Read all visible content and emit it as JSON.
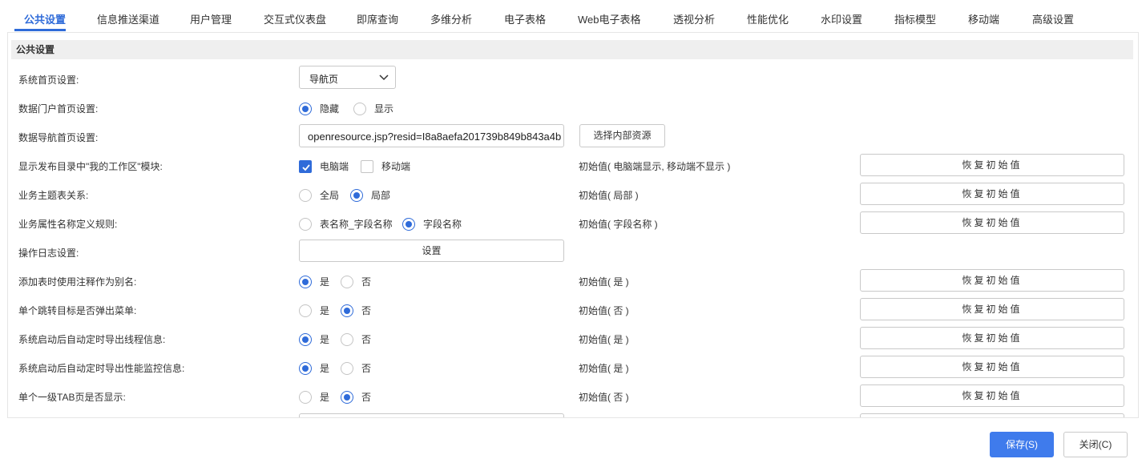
{
  "tabs": [
    {
      "label": "公共设置",
      "active": true
    },
    {
      "label": "信息推送渠道"
    },
    {
      "label": "用户管理"
    },
    {
      "label": "交互式仪表盘"
    },
    {
      "label": "即席查询"
    },
    {
      "label": "多维分析"
    },
    {
      "label": "电子表格"
    },
    {
      "label": "Web电子表格"
    },
    {
      "label": "透视分析"
    },
    {
      "label": "性能优化"
    },
    {
      "label": "水印设置"
    },
    {
      "label": "指标模型"
    },
    {
      "label": "移动端"
    },
    {
      "label": "高级设置"
    }
  ],
  "section": {
    "title": "公共设置"
  },
  "accent_color": "#2f6bd9",
  "restore_label": "恢复初始值",
  "settings": {
    "home_page": {
      "label": "系统首页设置:",
      "value": "导航页"
    },
    "portal_home": {
      "label": "数据门户首页设置:",
      "options": [
        "隐藏",
        "显示"
      ],
      "selected": "隐藏"
    },
    "nav_home": {
      "label": "数据导航首页设置:",
      "value": "openresource.jsp?resid=I8a8aefa201739b849b843a4b",
      "button": "选择内部资源"
    },
    "workspace_module": {
      "label": "显示发布目录中\"我的工作区\"模块:",
      "options": [
        {
          "label": "电脑端",
          "checked": true
        },
        {
          "label": "移动端",
          "checked": false
        }
      ],
      "initial": "初始值( 电脑端显示, 移动端不显示 )"
    },
    "topic_relation": {
      "label": "业务主题表关系:",
      "options": [
        "全局",
        "局部"
      ],
      "selected": "局部",
      "initial": "初始值( 局部 )"
    },
    "attr_naming": {
      "label": "业务属性名称定义规则:",
      "options": [
        "表名称_字段名称",
        "字段名称"
      ],
      "selected": "字段名称",
      "initial": "初始值( 字段名称 )"
    },
    "op_log": {
      "label": "操作日志设置:",
      "button": "设置"
    },
    "comment_alias": {
      "label": "添加表时使用注释作为别名:",
      "options": [
        "是",
        "否"
      ],
      "selected": "是",
      "initial": "初始值( 是 )"
    },
    "jump_menu": {
      "label": "单个跳转目标是否弹出菜单:",
      "options": [
        "是",
        "否"
      ],
      "selected": "否",
      "initial": "初始值( 否 )"
    },
    "export_threads": {
      "label": "系统启动后自动定时导出线程信息:",
      "options": [
        "是",
        "否"
      ],
      "selected": "是",
      "initial": "初始值( 是 )"
    },
    "export_perf": {
      "label": "系统启动后自动定时导出性能监控信息:",
      "options": [
        "是",
        "否"
      ],
      "selected": "是",
      "initial": "初始值( 是 )"
    },
    "single_tab": {
      "label": "单个一级TAB页是否显示:",
      "options": [
        "是",
        "否"
      ],
      "selected": "否",
      "initial": "初始值( 否 )"
    }
  },
  "footer": {
    "save": "保存(S)",
    "close": "关闭(C)"
  }
}
